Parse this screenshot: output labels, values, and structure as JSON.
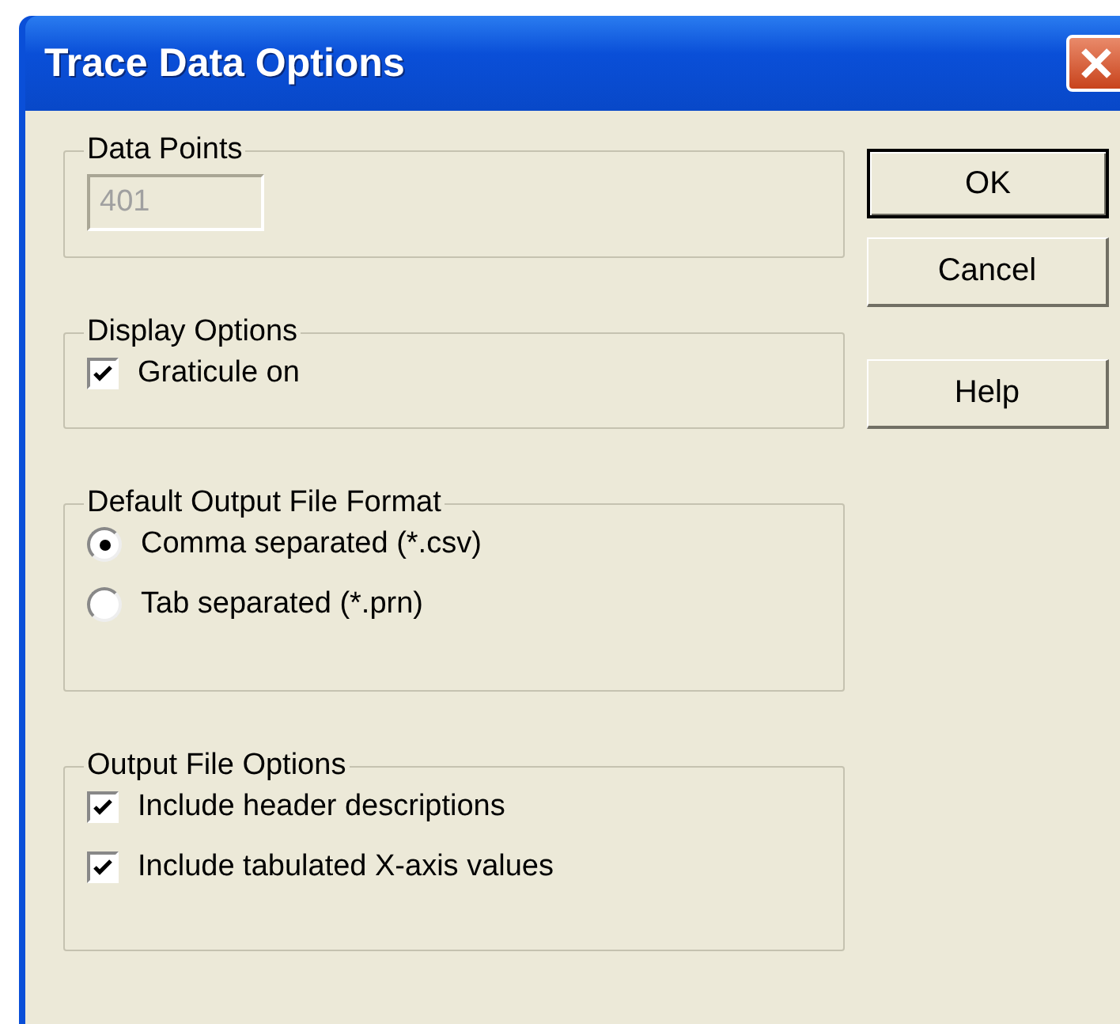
{
  "window": {
    "title": "Trace Data Options"
  },
  "groups": [
    {
      "title": "Data Points",
      "items": [
        {
          "kind": "field",
          "value": "401",
          "disabled": true
        }
      ]
    },
    {
      "title": "Display Options",
      "items": [
        {
          "kind": "checkbox",
          "label": "Graticule on",
          "checked": true
        }
      ]
    },
    {
      "title": "Default Output File Format",
      "items": [
        {
          "kind": "radio",
          "label": "Comma separated (*.csv)",
          "selected": true
        },
        {
          "kind": "radio",
          "label": "Tab separated (*.prn)",
          "selected": false
        }
      ]
    },
    {
      "title": "Output File Options",
      "items": [
        {
          "kind": "checkbox",
          "label": "Include header descriptions",
          "checked": true
        },
        {
          "kind": "checkbox",
          "label": "Include tabulated X-axis values",
          "checked": true
        }
      ]
    }
  ],
  "buttons": [
    {
      "label": "OK",
      "default": true
    },
    {
      "label": "Cancel",
      "default": false
    },
    {
      "label": "Help",
      "default": false
    }
  ]
}
